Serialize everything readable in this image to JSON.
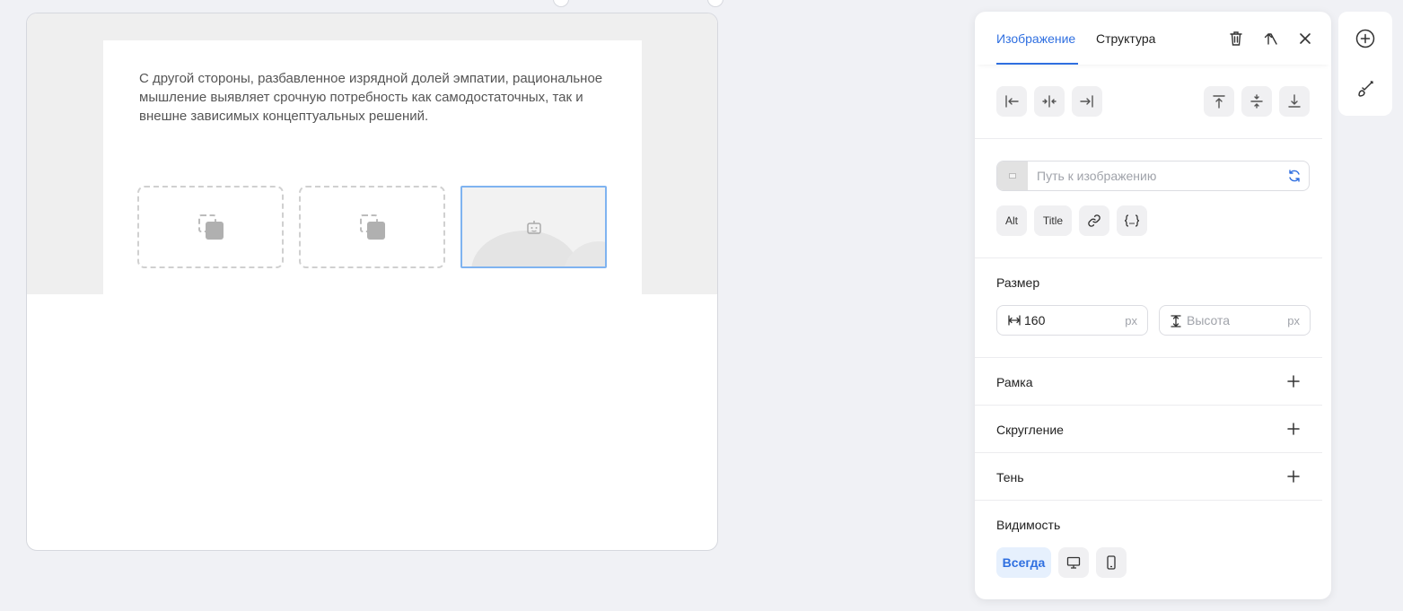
{
  "canvas": {
    "paragraph": "С другой стороны, разбавленное изрядной долей эмпатии, рациональное мышление выявляет срочную потребность как самодостаточных, так и внешне зависимых концептуальных решений."
  },
  "panel": {
    "tabs": [
      {
        "label": "Изображение",
        "active": true
      },
      {
        "label": "Структура",
        "active": false
      }
    ],
    "image_path": {
      "placeholder": "Путь к изображению",
      "value": ""
    },
    "chips": {
      "alt": "Alt",
      "title": "Title"
    },
    "size": {
      "label": "Размер",
      "width_value": "160",
      "width_unit": "px",
      "height_placeholder": "Высота",
      "height_unit": "px"
    },
    "sections": {
      "border": "Рамка",
      "radius": "Скругление",
      "shadow": "Тень"
    },
    "visibility": {
      "label": "Видимость",
      "always": "Всегда"
    }
  },
  "colors": {
    "accent": "#2f6fe0",
    "selection": "#7fb3f0"
  },
  "icons": [
    "align-left-icon",
    "align-center-h-icon",
    "align-right-icon",
    "align-top-icon",
    "align-middle-v-icon",
    "align-bottom-icon",
    "trash-icon",
    "parent-select-icon",
    "close-icon",
    "refresh-icon",
    "link-icon",
    "variable-icon",
    "width-icon",
    "height-icon",
    "plus-icon",
    "desktop-icon",
    "mobile-icon",
    "add-circle-icon",
    "brush-icon"
  ]
}
